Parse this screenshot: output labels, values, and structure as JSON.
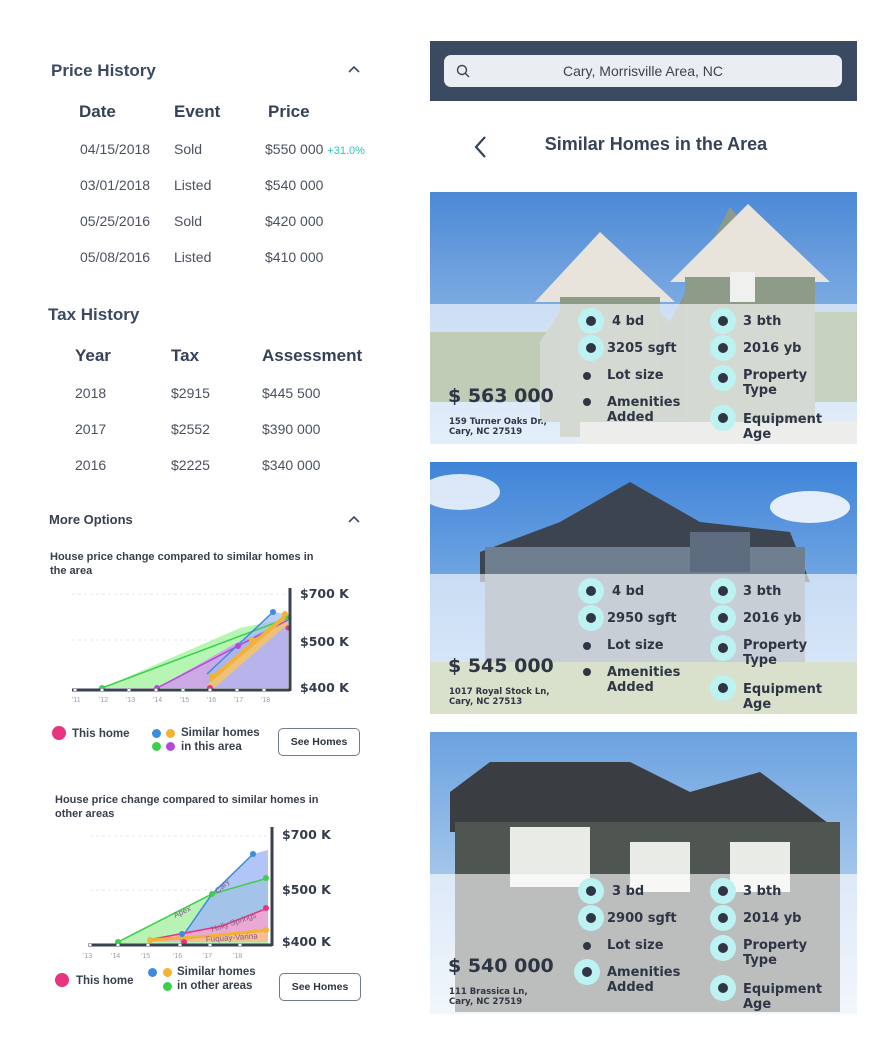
{
  "price_history": {
    "title": "Price History",
    "headers": [
      "Date",
      "Event",
      "Price"
    ],
    "rows": [
      {
        "date": "04/15/2018",
        "event": "Sold",
        "price": "$550 000",
        "change": "+31.0%"
      },
      {
        "date": "03/01/2018",
        "event": "Listed",
        "price": "$540 000",
        "change": ""
      },
      {
        "date": "05/25/2016",
        "event": "Sold",
        "price": "$420 000",
        "change": ""
      },
      {
        "date": "05/08/2016",
        "event": "Listed",
        "price": "$410 000",
        "change": ""
      }
    ]
  },
  "tax_history": {
    "title": "Tax History",
    "headers": [
      "Year",
      "Tax",
      "Assessment"
    ],
    "rows": [
      {
        "year": "2018",
        "tax": "$2915",
        "assessment": "$445 500"
      },
      {
        "year": "2017",
        "tax": "$2552",
        "assessment": "$390 000"
      },
      {
        "year": "2016",
        "tax": "$2225",
        "assessment": "$340 000"
      }
    ]
  },
  "more_options": {
    "title": "More Options",
    "chart1": {
      "title": "House price change compared to similar homes in the area",
      "legend_this": "This home",
      "legend_similar": "Similar homes in this area",
      "button": "See Homes"
    },
    "chart2": {
      "title": "House price change compared to similar homes in other areas",
      "legend_this": "This home",
      "legend_similar": "Similar homes in other areas",
      "button": "See Homes"
    }
  },
  "chart_data": [
    {
      "type": "area",
      "title": "House price change compared to similar homes in the area",
      "x": [
        "'11",
        "'12",
        "'13",
        "'14",
        "'15",
        "'16",
        "'17",
        "'18"
      ],
      "y_ticks": [
        "$400 K",
        "$500 K",
        "$700 K"
      ],
      "series": [
        {
          "name": "This home",
          "color": "#e8337f"
        },
        {
          "color": "#3d8bde"
        },
        {
          "color": "#f2b233"
        },
        {
          "color": "#3ccf4e"
        },
        {
          "color": "#b14bd6"
        }
      ]
    },
    {
      "type": "area",
      "title": "House price change compared to similar homes in other areas",
      "x": [
        "'13",
        "'14",
        "'15",
        "'16",
        "'17",
        "'18"
      ],
      "y_ticks": [
        "$400 K",
        "$500 K",
        "$700 K"
      ],
      "series": [
        {
          "name": "This home",
          "color": "#e8337f"
        },
        {
          "name": "Cary",
          "color": "#3d8bde"
        },
        {
          "name": "Apex",
          "color": "#3ccf4e"
        },
        {
          "name": "Holly Springs",
          "color": "#f2b233"
        },
        {
          "name": "Fuquay-Varina",
          "color": "#e8337f"
        }
      ]
    }
  ],
  "search": {
    "value": "Cary, Morrisville Area, NC"
  },
  "similar": {
    "title": "Similar Homes in the Area",
    "homes": [
      {
        "price": "$ 563 000",
        "addr1": "159 Turner Oaks Dr.,",
        "addr2": "Cary, NC 27519",
        "beds": "4 bd",
        "baths": "3 bth",
        "sqft": "3205 sgft",
        "year": "2016 yb",
        "lot": "Lot size",
        "property": "Property Type",
        "amenities": "Amenities Added",
        "equipment": "Equipment Age"
      },
      {
        "price": "$ 545 000",
        "addr1": "1017 Royal Stock Ln,",
        "addr2": "Cary, NC 27513",
        "beds": "4 bd",
        "baths": "3 bth",
        "sqft": "2950 sgft",
        "year": "2016 yb",
        "lot": "Lot size",
        "property": "Property Type",
        "amenities": "Amenities Added",
        "equipment": "Equipment Age"
      },
      {
        "price": "$ 540 000",
        "addr1": "111 Brassica Ln,",
        "addr2": "Cary, NC 27519",
        "beds": "3 bd",
        "baths": "3 bth",
        "sqft": "2900 sgft",
        "year": "2014 yb",
        "lot": "Lot size",
        "property": "Property Type",
        "amenities": "Amenities Added",
        "equipment": "Equipment Age"
      }
    ]
  }
}
